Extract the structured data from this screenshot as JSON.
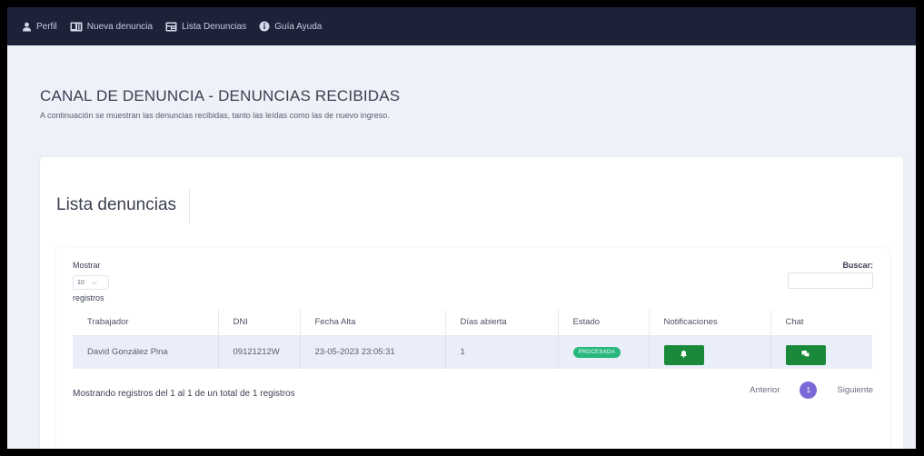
{
  "nav": {
    "items": [
      {
        "label": "Perfil",
        "icon": "user-icon"
      },
      {
        "label": "Nueva denuncia",
        "icon": "id-card-icon"
      },
      {
        "label": "Lista Denuncias",
        "icon": "newspaper-icon"
      },
      {
        "label": "Guía Ayuda",
        "icon": "info-circle-icon"
      }
    ]
  },
  "header": {
    "title": "CANAL DE DENUNCIA - DENUNCIAS RECIBIDAS",
    "subtitle": "A continuación se muestran las denuncias recibidas, tanto las leídas como las de nuevo ingreso."
  },
  "card": {
    "title": "Lista denuncias",
    "length": {
      "label_before": "Mostrar",
      "value": "10",
      "label_after": "registros"
    },
    "search": {
      "label": "Buscar:",
      "value": ""
    },
    "table": {
      "columns": [
        "Trabajador",
        "DNI",
        "Fecha Alta",
        "Días abierta",
        "Estado",
        "Notificaciones",
        "Chat"
      ],
      "rows": [
        {
          "trabajador": "David González Pina",
          "dni": "09121212W",
          "fecha_alta": "23-05-2023 23:05:31",
          "dias_abierta": "1",
          "estado": "PROCESADA"
        }
      ]
    },
    "info": "Mostrando registros del 1 al 1 de un total de 1 registros",
    "pager": {
      "prev": "Anterior",
      "current": "1",
      "next": "Siguiente"
    }
  },
  "colors": {
    "nav_bg": "#1e2238",
    "badge": "#28b77e",
    "button": "#1a8a3a",
    "page_active": "#7a6ad8"
  }
}
